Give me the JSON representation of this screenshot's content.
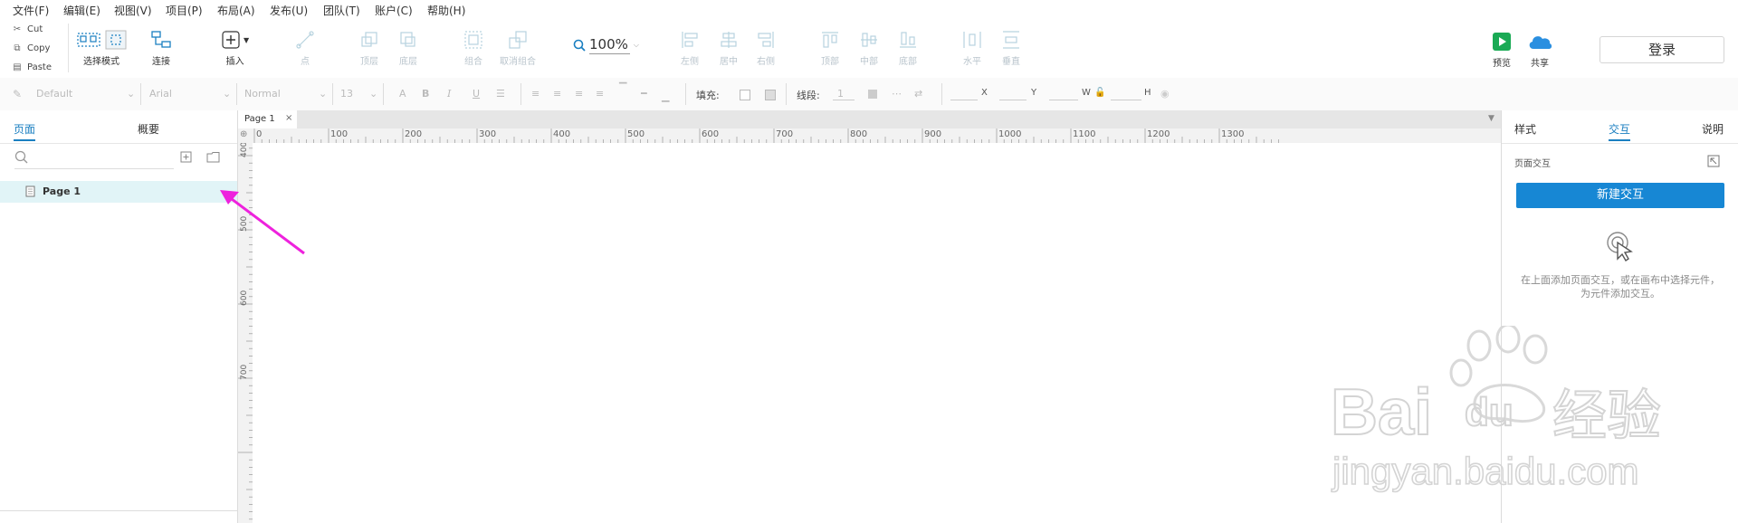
{
  "menu": [
    "文件(F)",
    "编辑(E)",
    "视图(V)",
    "项目(P)",
    "布局(A)",
    "发布(U)",
    "团队(T)",
    "账户(C)",
    "帮助(H)"
  ],
  "clipboard": {
    "cut": "Cut",
    "copy": "Copy",
    "paste": "Paste"
  },
  "toolbar": {
    "select_mode": "选择模式",
    "connect": "连接",
    "insert": "插入",
    "point": "点",
    "top_layer": "顶层",
    "bottom_layer": "底层",
    "group": "组合",
    "ungroup": "取消组合",
    "left": "左侧",
    "center": "居中",
    "right": "右侧",
    "top": "顶部",
    "middle": "中部",
    "bottom": "底部",
    "horizontal": "水平",
    "vertical": "垂直",
    "preview": "预览",
    "share": "共享",
    "zoom": "100%",
    "login": "登录"
  },
  "format": {
    "style": "Default",
    "font": "Arial",
    "weight": "Normal",
    "size": "13",
    "fill_label": "填充:",
    "stroke_label": "线段:",
    "stroke_value": "1",
    "x": "X",
    "y": "Y",
    "w": "W",
    "h": "H"
  },
  "left_panel": {
    "tab_pages": "页面",
    "tab_outline": "概要",
    "page1": "Page 1"
  },
  "canvas": {
    "tab": "Page 1",
    "h_ticks": [
      "0",
      "100",
      "200",
      "300",
      "400",
      "500",
      "600",
      "700",
      "800",
      "900",
      "1000",
      "1100",
      "1200",
      "1300"
    ],
    "v_ticks": [
      "400",
      "500",
      "600",
      "700"
    ]
  },
  "right_panel": {
    "tab_style": "样式",
    "tab_interact": "交互",
    "tab_notes": "说明",
    "page_interactions": "页面交互",
    "new_interaction": "新建交互",
    "hint": "在上面添加页面交互，或在画布中选择元件，为元件添加交互。"
  },
  "watermark": {
    "brand_left": "Bai",
    "brand_right": "du",
    "brand_cn": "经验",
    "url": "jingyan.baidu.com"
  },
  "colors": {
    "accent": "#1a7fc1",
    "button": "#1787d4",
    "selected_row": "#e1f4f7",
    "arrow": "#ee22dd",
    "preview_green": "#1aaa55",
    "share_blue": "#2a8fe0"
  }
}
